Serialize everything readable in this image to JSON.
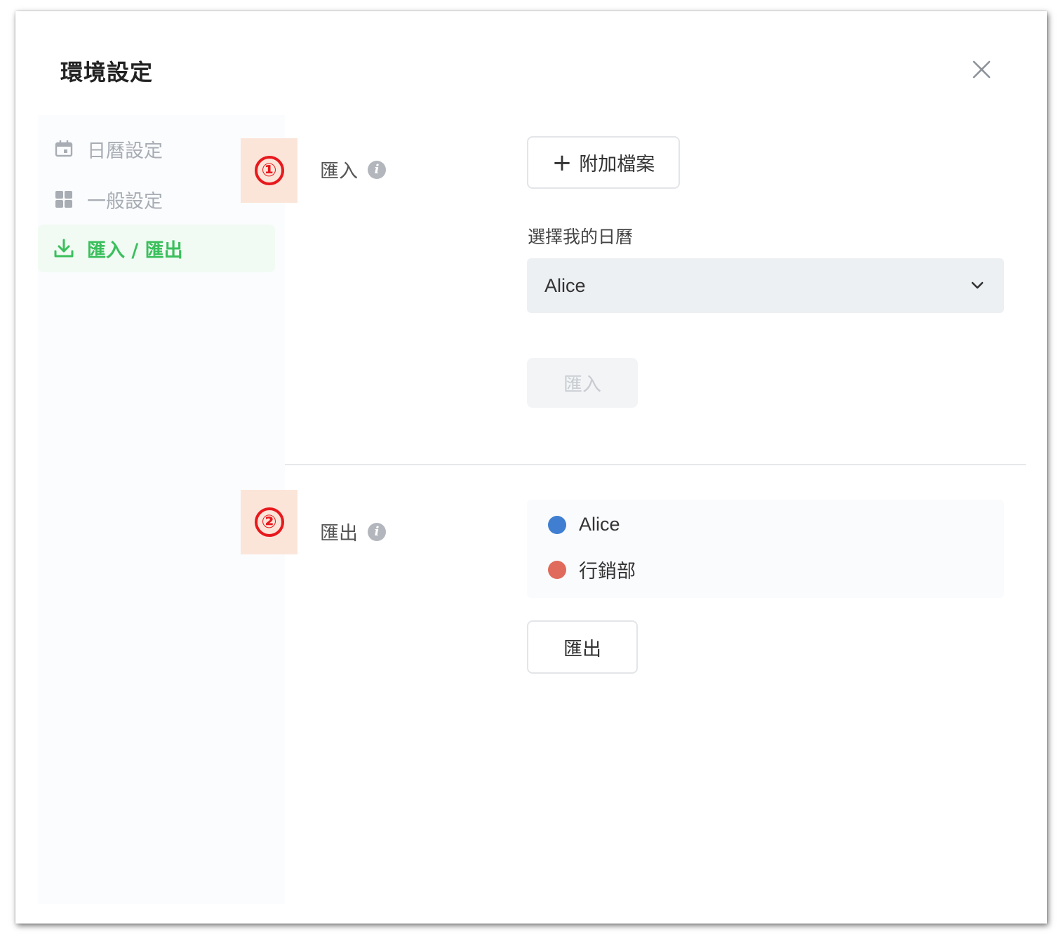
{
  "dialog": {
    "title": "環境設定"
  },
  "sidebar": {
    "items": [
      {
        "label": "日曆設定",
        "icon": "calendar-icon",
        "active": false
      },
      {
        "label": "一般設定",
        "icon": "grid-icon",
        "active": false
      },
      {
        "label": "匯入 / 匯出",
        "icon": "download-icon",
        "active": true
      }
    ]
  },
  "markers": [
    "①",
    "②"
  ],
  "import": {
    "label": "匯入",
    "attach_button": "附加檔案",
    "calendar_label": "選擇我的日曆",
    "selected_calendar": "Alice",
    "submit_button": "匯入"
  },
  "export": {
    "label": "匯出",
    "calendars": [
      {
        "name": "Alice",
        "color": "#3f7ed1"
      },
      {
        "name": "行銷部",
        "color": "#e06a5b"
      }
    ],
    "submit_button": "匯出"
  },
  "colors": {
    "accent": "#3bbf5c",
    "marker_bg": "#fbe5d9",
    "marker_red": "#e8191d"
  }
}
